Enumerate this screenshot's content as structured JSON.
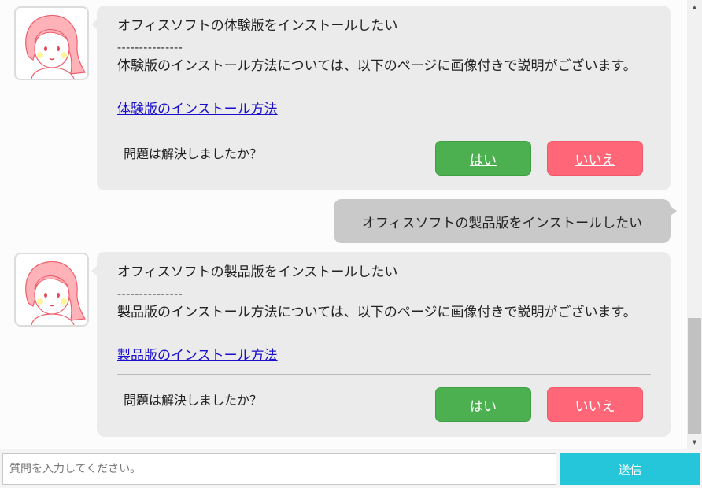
{
  "messages": [
    {
      "type": "bot",
      "question": "オフィスソフトの体験版をインストールしたい",
      "separator": "---------------",
      "answer": "体験版のインストール方法については、以下のページに画像付きで説明がございます。",
      "link": "体験版のインストール方法",
      "feedback_prompt": "問題は解決しましたか？",
      "yes_label": "はい",
      "no_label": "いいえ"
    },
    {
      "type": "user",
      "text": "オフィスソフトの製品版をインストールしたい"
    },
    {
      "type": "bot",
      "question": "オフィスソフトの製品版をインストールしたい",
      "separator": "---------------",
      "answer": "製品版のインストール方法については、以下のページに画像付きで説明がございます。",
      "link": "製品版のインストール方法",
      "feedback_prompt": "問題は解決しましたか？",
      "yes_label": "はい",
      "no_label": "いいえ"
    }
  ],
  "input": {
    "placeholder": "質問を入力してください。",
    "value": ""
  },
  "send_label": "送信",
  "colors": {
    "bot_bubble": "#ebebeb",
    "user_bubble": "#c9c9c9",
    "yes_button": "#4caf50",
    "no_button": "#ff6677",
    "send_button": "#26c6da",
    "link": "#1a0dcc"
  },
  "icons": {
    "avatar": "girl-avatar-icon",
    "scroll_up": "triangle-up-icon",
    "scroll_down": "triangle-down-icon"
  }
}
